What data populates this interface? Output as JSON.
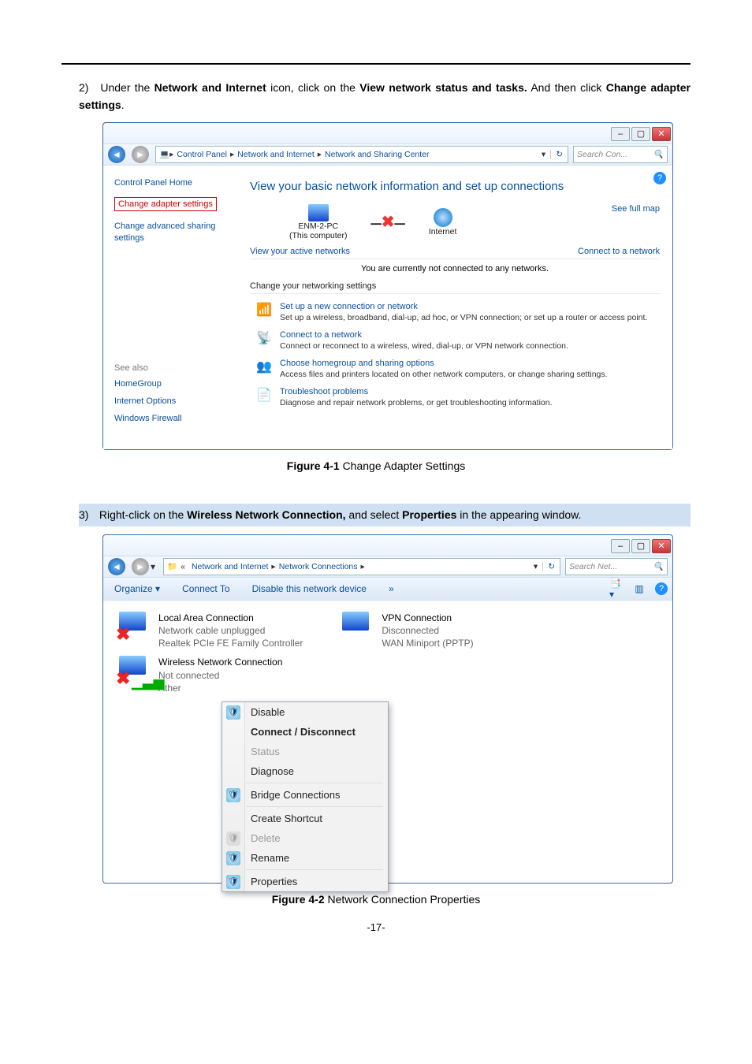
{
  "page_number": "-17-",
  "steps": {
    "s2": {
      "num": "2)",
      "t1": "Under the ",
      "b1": "Network and Internet",
      "t2": " icon, click on the ",
      "b2": "View network status and tasks.",
      "t3": " And then click ",
      "b3": "Change adapter settings",
      "t4": "."
    },
    "s3": {
      "num": "3)",
      "t1": "Right-click on the ",
      "b1": "Wireless Network Connection,",
      "t2": " and select ",
      "b2": "Properties",
      "t3": " in the appearing window."
    }
  },
  "captions": {
    "fig1": {
      "bold": "Figure 4-1",
      "rest": "Change Adapter Settings"
    },
    "fig2": {
      "bold": "Figure 4-2",
      "rest": "Network Connection Properties"
    }
  },
  "win1": {
    "breadcrumb": [
      "Control Panel",
      "Network and Internet",
      "Network and Sharing Center"
    ],
    "search_placeholder": "Search Con...",
    "left": {
      "home": "Control Panel Home",
      "adapter": "Change adapter settings",
      "advanced": "Change advanced sharing settings",
      "see_also": "See also",
      "links": [
        "HomeGroup",
        "Internet Options",
        "Windows Firewall"
      ]
    },
    "heading": "View your basic network information and set up connections",
    "see_full_map": "See full map",
    "diagram": {
      "pc_name": "ENM-2-PC",
      "pc_sub": "(This computer)",
      "internet": "Internet"
    },
    "view_active": "View your active networks",
    "connect_link": "Connect to a network",
    "not_connected": "You are currently not connected to any networks.",
    "change_settings": "Change your networking settings",
    "options": [
      {
        "title": "Set up a new connection or network",
        "desc": "Set up a wireless, broadband, dial-up, ad hoc, or VPN connection; or set up a router or access point."
      },
      {
        "title": "Connect to a network",
        "desc": "Connect or reconnect to a wireless, wired, dial-up, or VPN network connection."
      },
      {
        "title": "Choose homegroup and sharing options",
        "desc": "Access files and printers located on other network computers, or change sharing settings."
      },
      {
        "title": "Troubleshoot problems",
        "desc": "Diagnose and repair network problems, or get troubleshooting information."
      }
    ]
  },
  "win2": {
    "breadcrumb": [
      "Network and Internet",
      "Network Connections"
    ],
    "search_placeholder": "Search Net...",
    "toolbar": [
      "Organize",
      "Connect To",
      "Disable this network device",
      "»"
    ],
    "conns": [
      {
        "title": "Local Area Connection",
        "status": "Network cable unplugged",
        "device": "Realtek PCIe FE Family Controller"
      },
      {
        "title": "VPN Connection",
        "status": "Disconnected",
        "device": "WAN Miniport (PPTP)"
      },
      {
        "title": "Wireless Network Connection",
        "status": "Not connected",
        "device": "Ather"
      }
    ],
    "menu": [
      "Disable",
      "Connect / Disconnect",
      "Status",
      "Diagnose",
      "Bridge Connections",
      "Create Shortcut",
      "Delete",
      "Rename",
      "Properties"
    ]
  }
}
